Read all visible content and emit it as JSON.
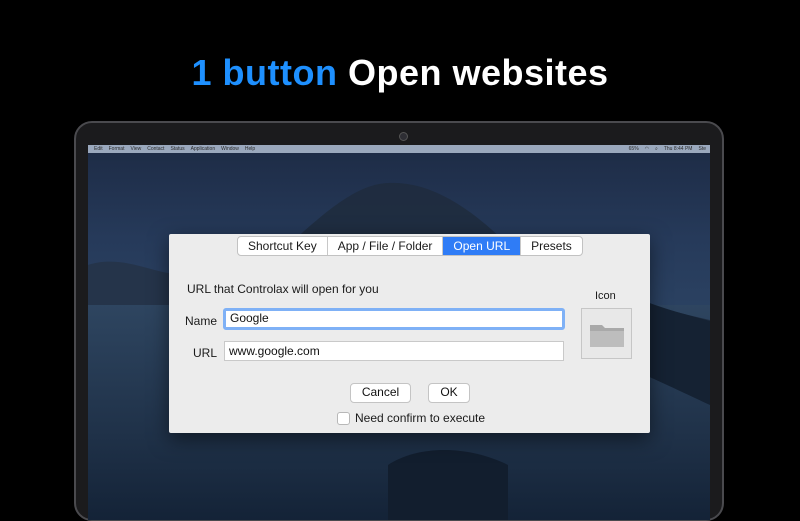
{
  "headline": {
    "accent": "1 button",
    "rest": "Open websites"
  },
  "menubar": {
    "items": [
      "Edit",
      "Format",
      "View",
      "Contact",
      "Status",
      "Application",
      "Window",
      "Help"
    ],
    "status": [
      "65%",
      "Thu 8:44 PM",
      "Ste"
    ]
  },
  "dialog": {
    "tabs": [
      "Shortcut Key",
      "App / File / Folder",
      "Open URL",
      "Presets"
    ],
    "active_tab": "Open URL",
    "description": "URL that Controlax will open for you",
    "name_label": "Name",
    "name_value": "Google",
    "url_label": "URL",
    "url_value": "www.google.com",
    "icon_label": "Icon",
    "cancel_label": "Cancel",
    "ok_label": "OK",
    "confirm_label": "Need confirm to execute",
    "confirm_checked": false
  },
  "colors": {
    "accent": "#1e90ff",
    "active_tab": "#2f7cf6",
    "focus_ring": "#7fb1f6"
  },
  "icons": [
    "camera-icon",
    "folder-icon",
    "wifi-icon",
    "battery-icon",
    "search-icon"
  ]
}
